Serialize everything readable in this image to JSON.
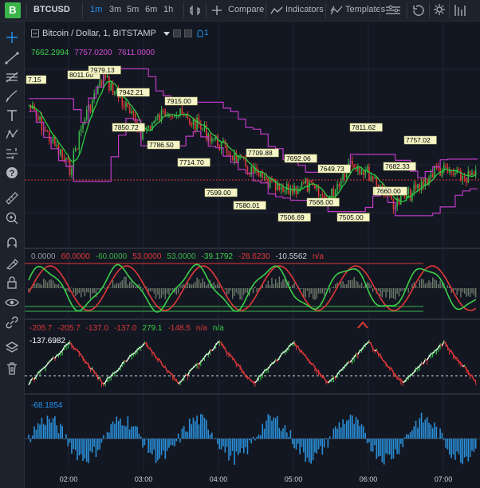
{
  "app": {
    "logo": "B",
    "symbol": "BTCUSD",
    "timeframes": [
      "1m",
      "3m",
      "5m",
      "6m",
      "1h"
    ],
    "active_timeframe": "1m",
    "compare_label": "Compare",
    "indicators_label": "Indicators",
    "templates_label": "Templates"
  },
  "main_pane": {
    "title": "Bitcoin / Dollar, 1, BITSTAMP",
    "badge": "1",
    "values": [
      {
        "text": "7662.2994",
        "color": "#3bd04a"
      },
      {
        "text": "7757.0200",
        "color": "#d14dd6"
      },
      {
        "text": "7611.0000",
        "color": "#d14dd6"
      }
    ],
    "price_labels": [
      "7.15",
      "8011.00",
      "7979.13",
      "7942.21",
      "7850.72",
      "7915.00",
      "7786.50",
      "7714.70",
      "7599.00",
      "7709.88",
      "7580.01",
      "7692.06",
      "7506.69",
      "7566.00",
      "7649.73",
      "7505.00",
      "7811.62",
      "7757.02",
      "7682.33",
      "7660.00",
      "7660.00"
    ]
  },
  "osc_pane": {
    "values": [
      {
        "text": "0.0000",
        "color": "#9598a1"
      },
      {
        "text": "60.0000",
        "color": "#e03838"
      },
      {
        "text": "-60.0000",
        "color": "#3bb44a"
      },
      {
        "text": "53.0000",
        "color": "#e03838"
      },
      {
        "text": "53.0000",
        "color": "#3bb44a"
      },
      {
        "text": "-39.1792",
        "color": "#3bd04a"
      },
      {
        "text": "-28.6230",
        "color": "#e03838"
      },
      {
        "text": "-10.5562",
        "color": "#d1d4dc"
      },
      {
        "text": "n/a",
        "color": "#e03838"
      }
    ]
  },
  "wave_pane": {
    "values": [
      {
        "text": "-205.7",
        "color": "#e03838"
      },
      {
        "text": "-205.7",
        "color": "#e03838"
      },
      {
        "text": "-137.0",
        "color": "#e03838"
      },
      {
        "text": "-137.0",
        "color": "#e03838"
      },
      {
        "text": "279.1",
        "color": "#3bd04a"
      },
      {
        "text": "-148.5",
        "color": "#e03838"
      },
      {
        "text": "n/a",
        "color": "#e03838"
      },
      {
        "text": "n/a",
        "color": "#3bd04a"
      }
    ],
    "current": "-137.6982"
  },
  "hist_pane": {
    "current": "-68.1854"
  },
  "time_axis": {
    "labels": [
      "02:00",
      "03:00",
      "04:00",
      "05:00",
      "06:00",
      "07:00"
    ]
  }
}
